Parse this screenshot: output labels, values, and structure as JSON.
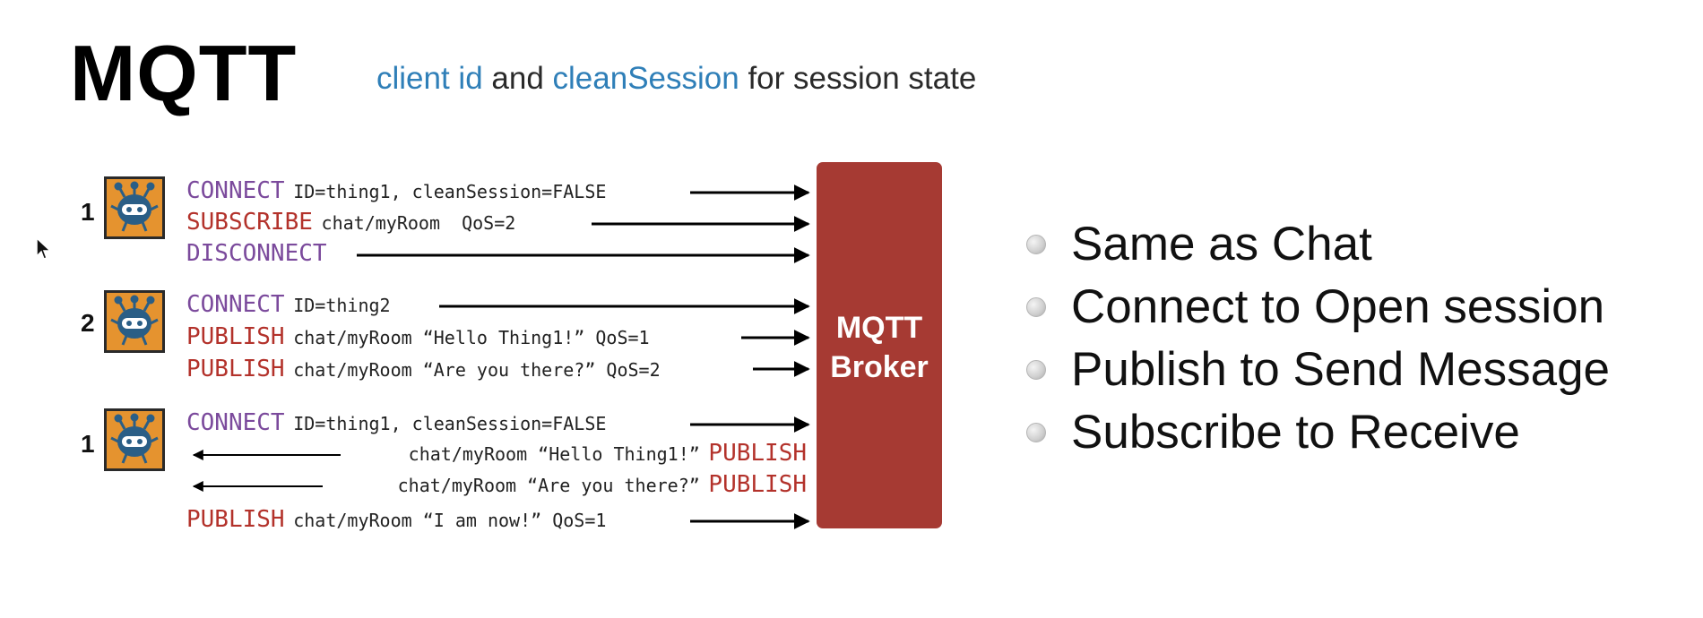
{
  "title": "MQTT",
  "subtitle": {
    "part1": "client id",
    "part2": " and ",
    "part3": "cleanSession",
    "part4": " for session state"
  },
  "broker": {
    "line1": "MQTT",
    "line2": "Broker",
    "color": "#a63a33"
  },
  "clients": [
    {
      "number": "1",
      "icon": "robot-icon"
    },
    {
      "number": "2",
      "icon": "robot-icon"
    },
    {
      "number": "1",
      "icon": "robot-icon"
    }
  ],
  "messages": [
    {
      "keyword": "CONNECT",
      "args": "ID=thing1, cleanSession=FALSE",
      "direction": "to-broker"
    },
    {
      "keyword": "SUBSCRIBE",
      "args": "chat/myRoom  QoS=2",
      "direction": "to-broker"
    },
    {
      "keyword": "DISCONNECT",
      "args": "",
      "direction": "to-broker"
    },
    {
      "keyword": "CONNECT",
      "args": "ID=thing2",
      "direction": "to-broker"
    },
    {
      "keyword": "PUBLISH",
      "args": "chat/myRoom “Hello Thing1!” QoS=1",
      "direction": "to-broker"
    },
    {
      "keyword": "PUBLISH",
      "args": "chat/myRoom “Are you there?” QoS=2",
      "direction": "to-broker"
    },
    {
      "keyword": "CONNECT",
      "args": "ID=thing1, cleanSession=FALSE",
      "direction": "to-broker"
    },
    {
      "keyword": "PUBLISH",
      "args": "chat/myRoom “Hello Thing1!”",
      "direction": "to-client"
    },
    {
      "keyword": "PUBLISH",
      "args": "chat/myRoom “Are you there?”",
      "direction": "to-client"
    },
    {
      "keyword": "PUBLISH",
      "args": "chat/myRoom “I am now!” QoS=1",
      "direction": "to-broker"
    }
  ],
  "bullets": [
    "Same as Chat",
    "Connect to Open session",
    "Publish to Send Message",
    "Subscribe to Receive"
  ],
  "colors": {
    "connect": "#7b4a9c",
    "publish": "#b3322b",
    "highlight": "#2f7fb8",
    "icon": "#e5932f"
  }
}
